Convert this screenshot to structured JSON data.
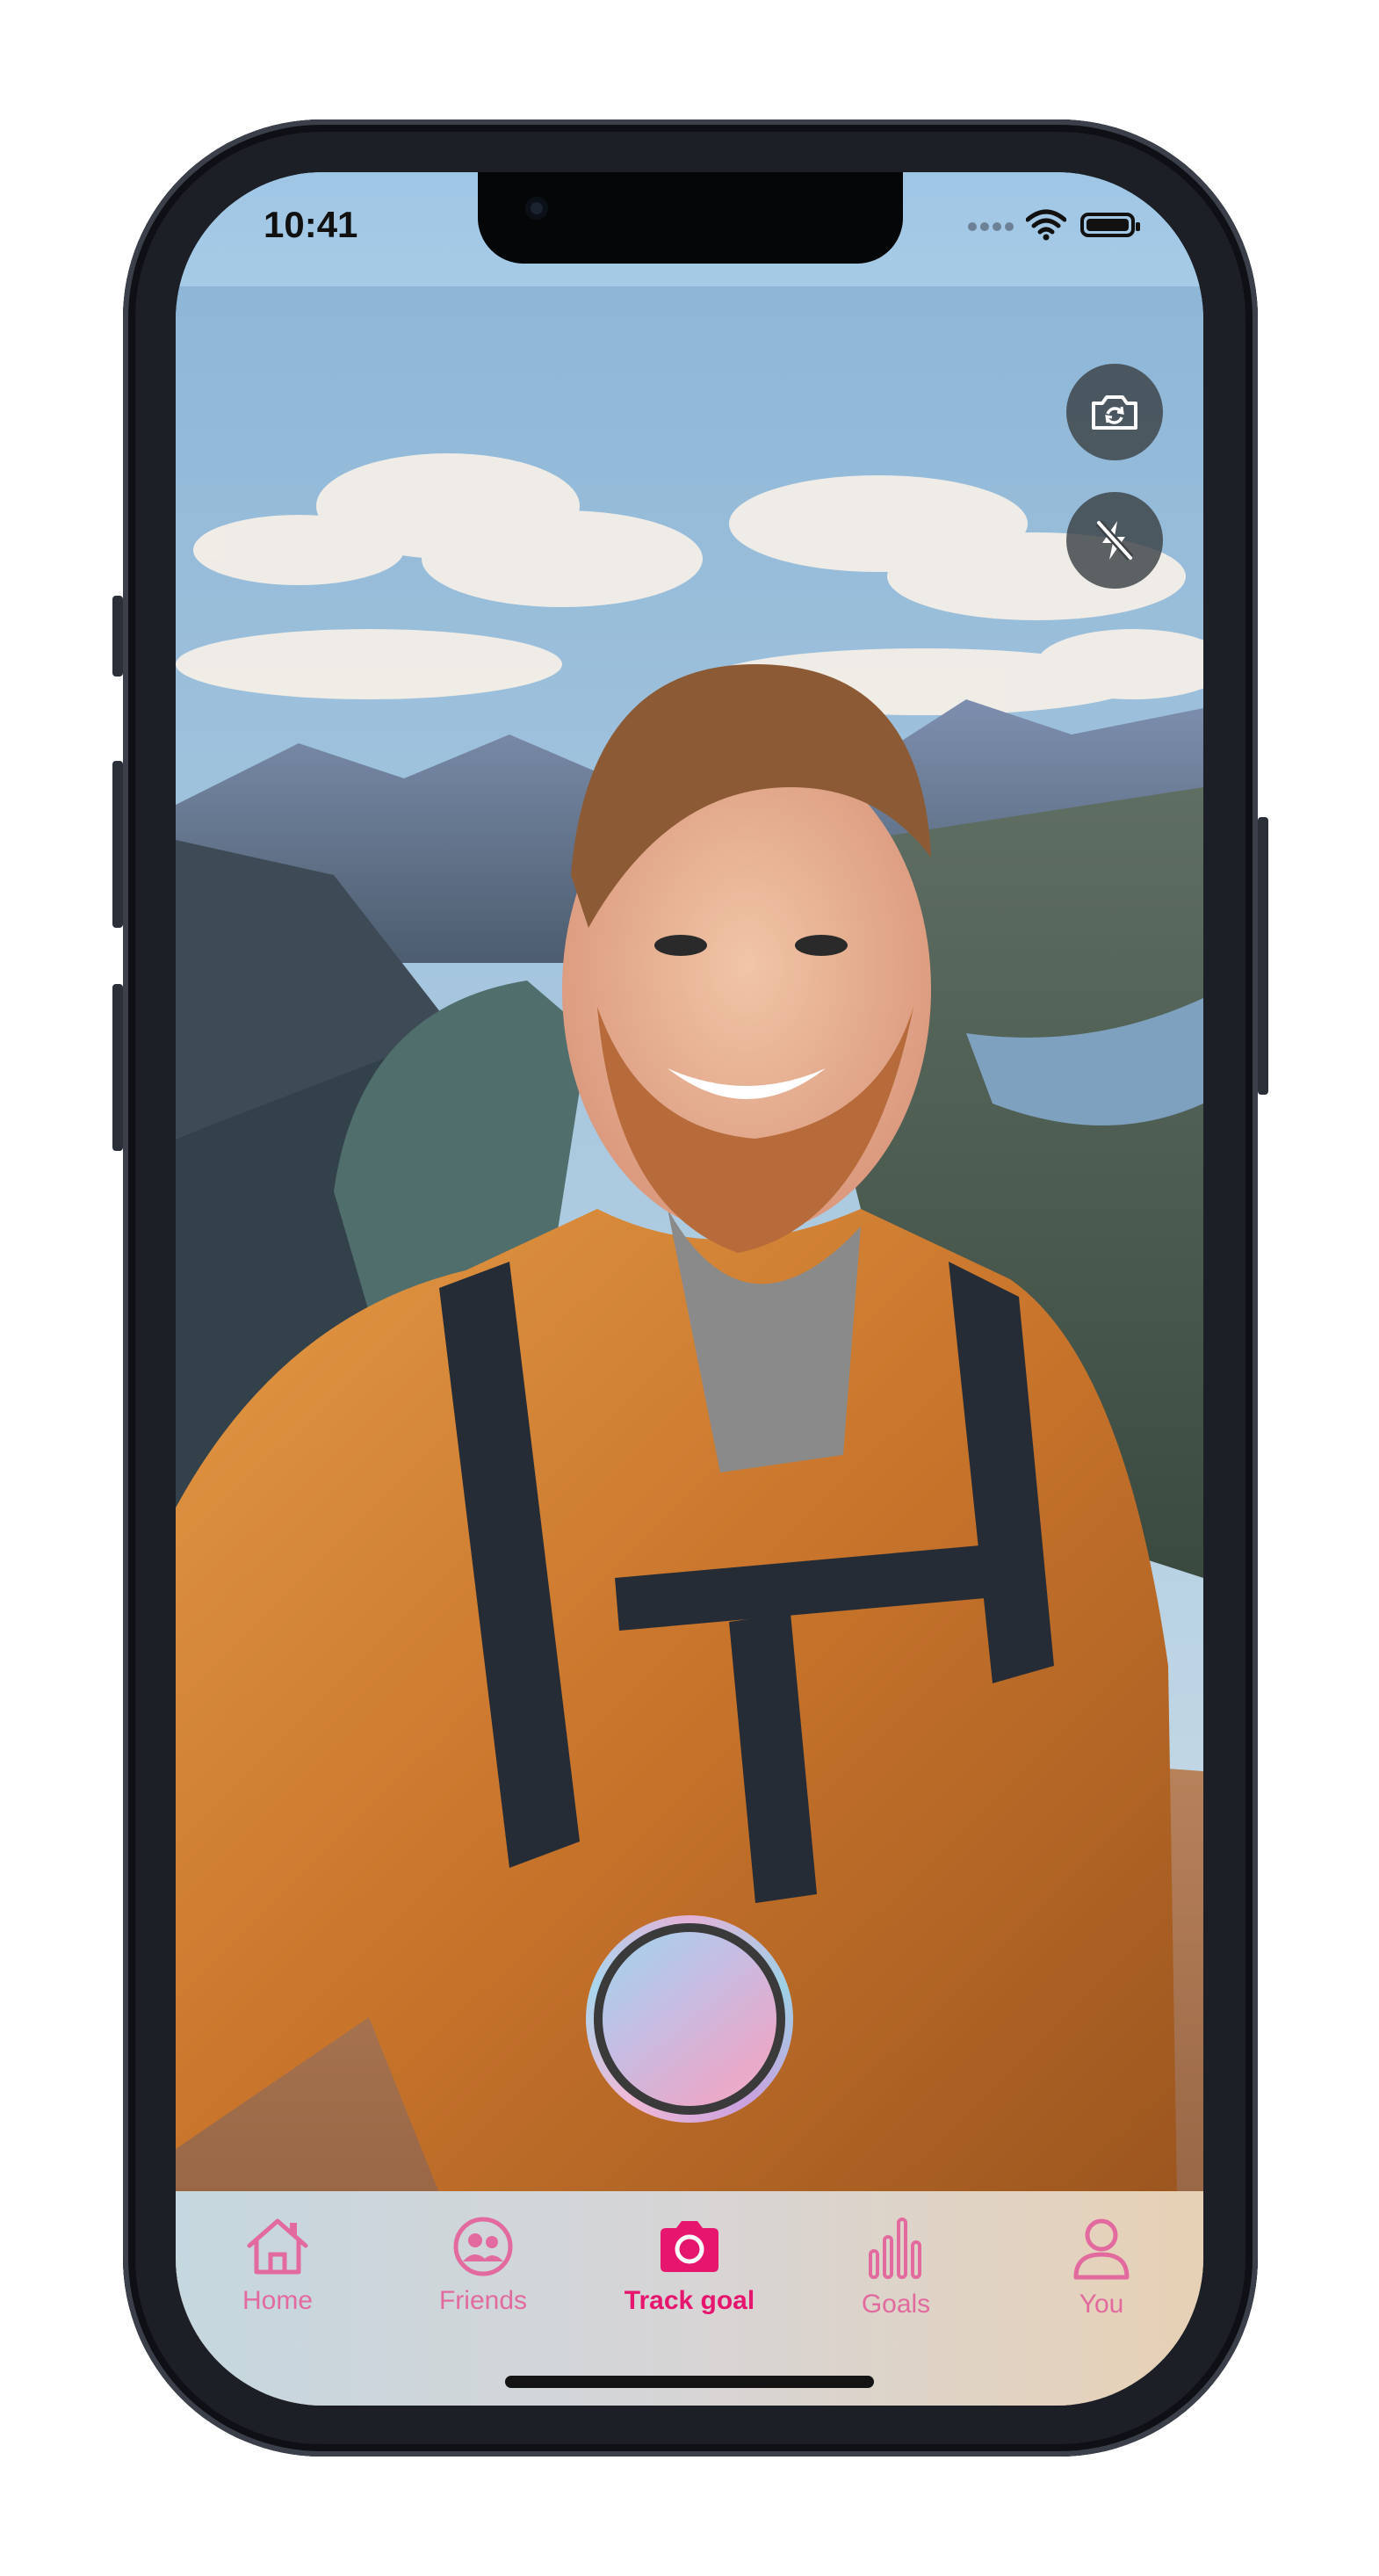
{
  "status_bar": {
    "time": "10:41"
  },
  "camera": {
    "flip_camera_label": "Switch camera",
    "flash_label": "Flash off",
    "shutter_label": "Capture"
  },
  "tabs": [
    {
      "label": "Home",
      "icon": "home-icon",
      "active": false
    },
    {
      "label": "Friends",
      "icon": "friends-icon",
      "active": false
    },
    {
      "label": "Track goal",
      "icon": "camera-icon",
      "active": true
    },
    {
      "label": "Goals",
      "icon": "bar-chart-icon",
      "active": false
    },
    {
      "label": "You",
      "icon": "profile-icon",
      "active": false
    }
  ],
  "colors": {
    "accent": "#e6166f",
    "inactive_tab": "#e26a9f",
    "tabbar_start": "#c5d7df",
    "tabbar_end": "#e7d1b5"
  }
}
